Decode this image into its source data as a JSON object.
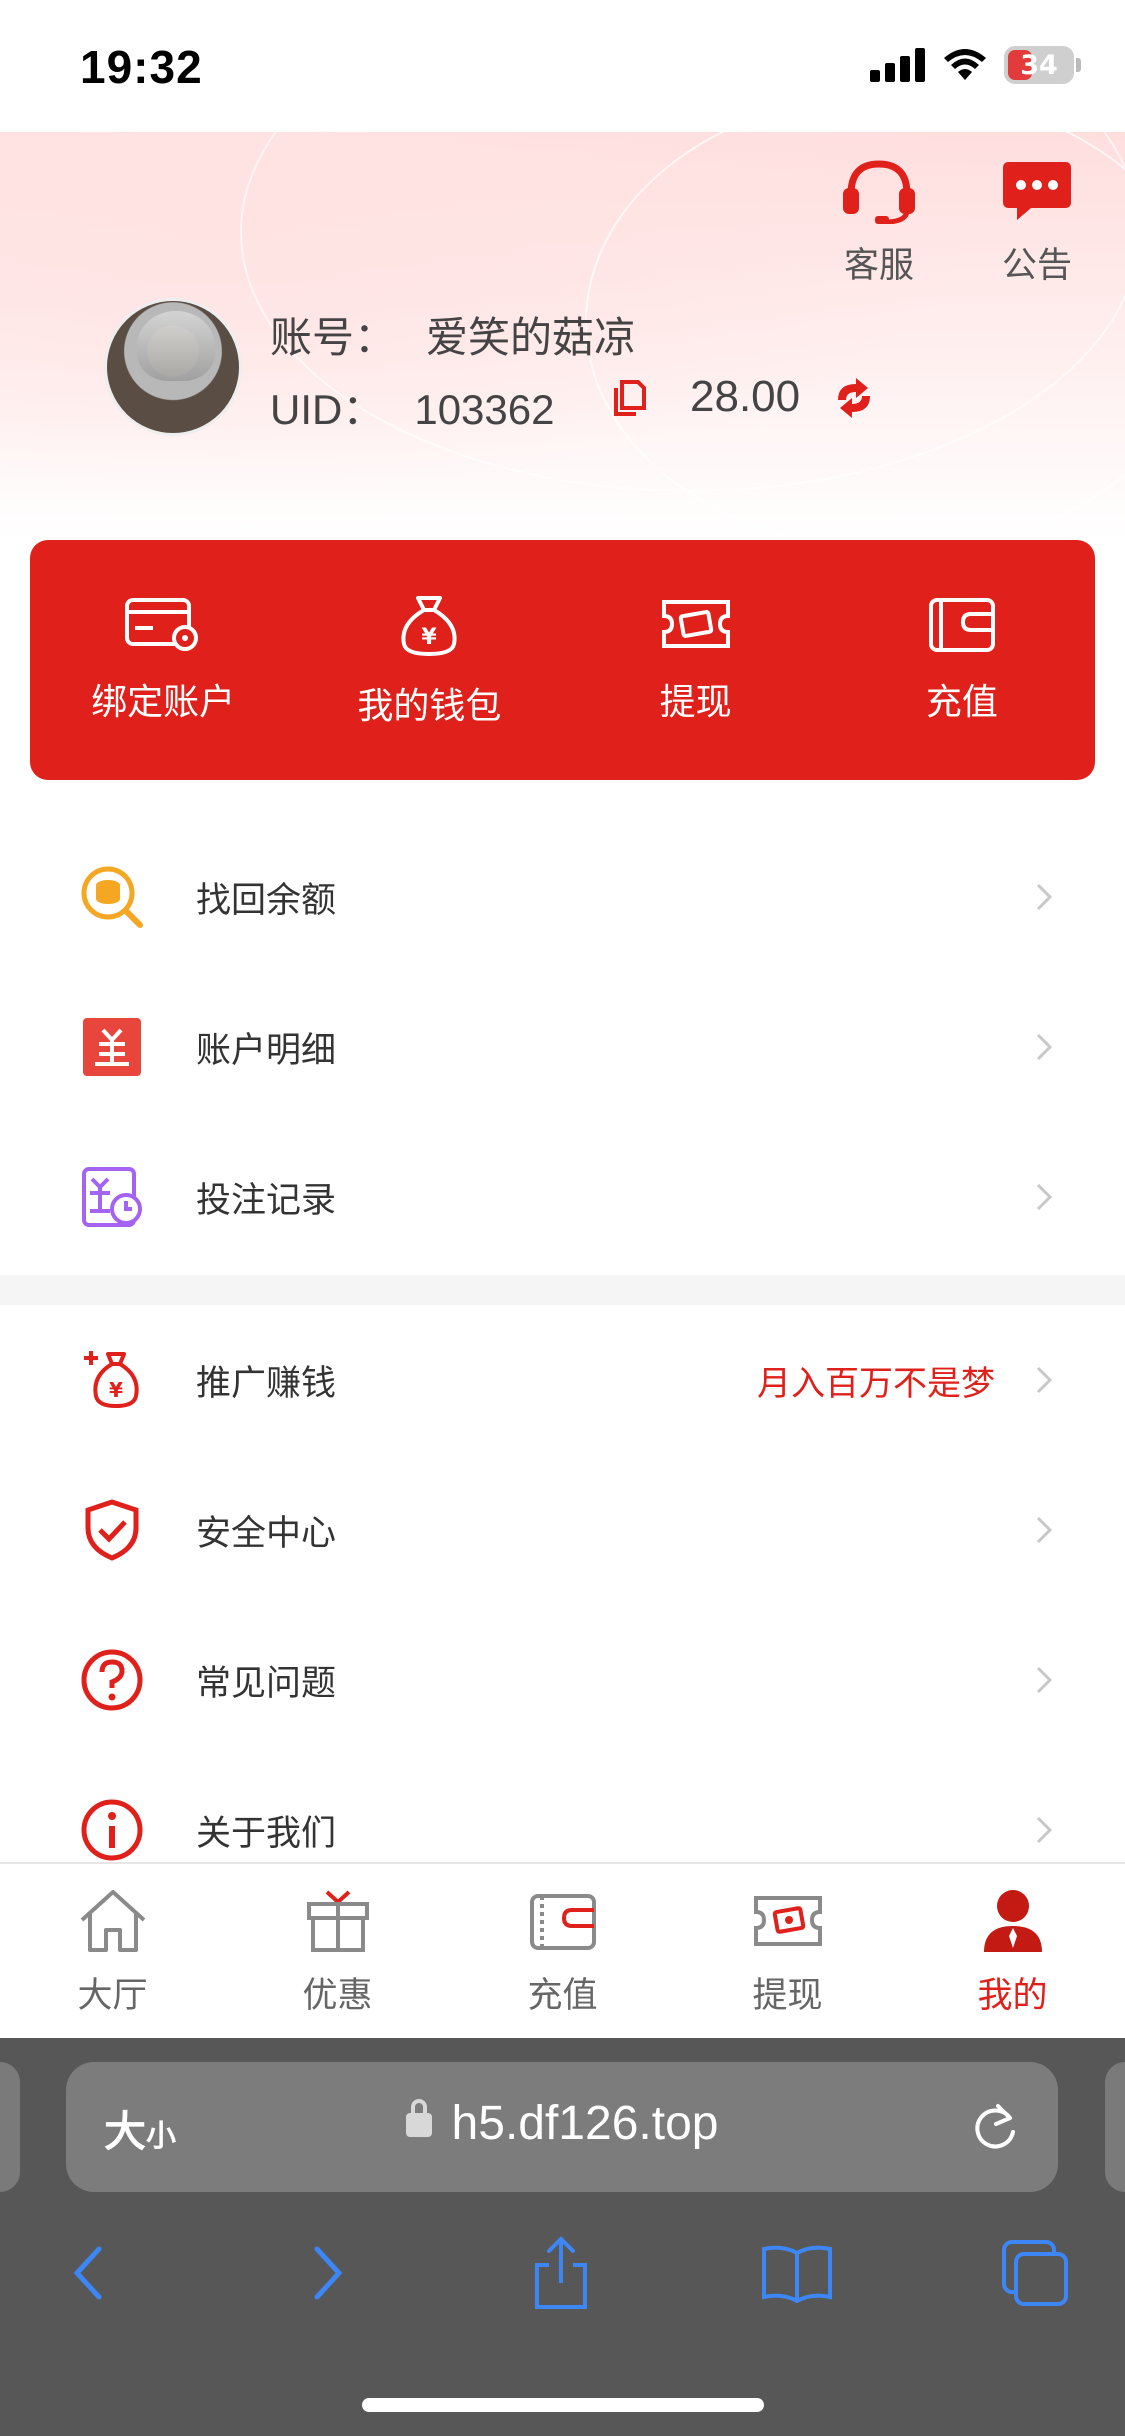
{
  "status_bar": {
    "time": "19:32",
    "battery": "34"
  },
  "header": {
    "customer_service_label": "客服",
    "notice_label": "公告",
    "account_label": "账号：",
    "account_value": "爱笑的菇凉",
    "uid_label": "UID：",
    "uid_value": "103362",
    "balance": "28.00"
  },
  "quick_actions": [
    {
      "label": "绑定账户",
      "icon": "bank-card-gear-icon"
    },
    {
      "label": "我的钱包",
      "icon": "money-bag-icon"
    },
    {
      "label": "提现",
      "icon": "ticket-withdraw-icon"
    },
    {
      "label": "充值",
      "icon": "wallet-icon"
    }
  ],
  "menu_section_1": [
    {
      "label": "找回余额",
      "icon": "coin-search-icon",
      "icon_color": "#f5a623"
    },
    {
      "label": "账户明细",
      "icon": "yuan-document-icon",
      "icon_color": "#e8453c"
    },
    {
      "label": "投注记录",
      "icon": "betting-record-icon",
      "icon_color": "#a463f2"
    }
  ],
  "menu_section_2": [
    {
      "label": "推广赚钱",
      "extra": "月入百万不是梦",
      "icon": "money-bag-plus-icon",
      "icon_color": "#e0201a"
    },
    {
      "label": "安全中心",
      "extra": "",
      "icon": "shield-check-icon",
      "icon_color": "#e0201a"
    },
    {
      "label": "常见问题",
      "extra": "",
      "icon": "question-circle-icon",
      "icon_color": "#e0201a"
    },
    {
      "label": "关于我们",
      "extra": "",
      "icon": "info-circle-icon",
      "icon_color": "#e0201a"
    }
  ],
  "tabbar": [
    {
      "label": "大厅",
      "icon": "home-icon",
      "active": false
    },
    {
      "label": "优惠",
      "icon": "gift-icon",
      "active": false
    },
    {
      "label": "充值",
      "icon": "wallet-icon",
      "active": false
    },
    {
      "label": "提现",
      "icon": "ticket-icon",
      "active": false
    },
    {
      "label": "我的",
      "icon": "user-icon",
      "active": true
    }
  ],
  "browser": {
    "text_size_label": "大",
    "text_size_small": "小",
    "url": "h5.df126.top"
  },
  "colors": {
    "brand_red": "#e0201a",
    "browser_chrome": "#575757",
    "link_blue": "#3d86f5"
  }
}
